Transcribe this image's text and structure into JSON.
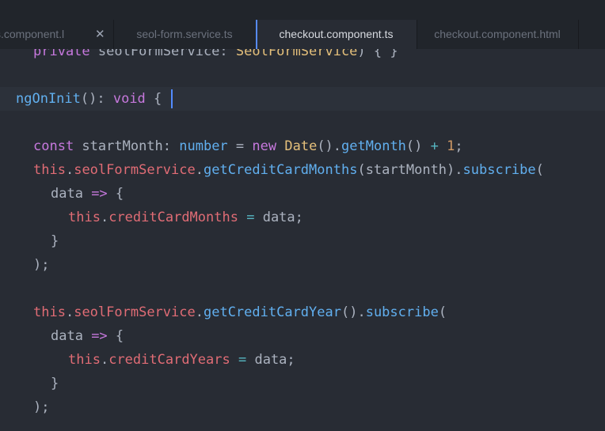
{
  "tabs": [
    {
      "label": "s.component.l",
      "close": "✕"
    },
    {
      "label": "seol-form.service.ts"
    },
    {
      "label": "checkout.component.ts"
    },
    {
      "label": "checkout.component.html"
    }
  ],
  "code": {
    "line0": {
      "a": "private",
      "b": " seolFormService: ",
      "c": "SeolFormService",
      "d": ") { }"
    },
    "line1": {
      "a": "ngOnInit",
      "b": "(): ",
      "c": "void",
      "d": " {"
    },
    "line2": {
      "a": "const",
      "b": " startMonth: ",
      "c": "number",
      "d": " = ",
      "e": "new",
      "f": " ",
      "g": "Date",
      "h": "().",
      "i": "getMonth",
      "j": "() ",
      "k": "+",
      "l": " ",
      "m": "1",
      "n": ";"
    },
    "line3": {
      "a": "this",
      "b": ".",
      "c": "seolFormService",
      "d": ".",
      "e": "getCreditCardMonths",
      "f": "(startMonth).",
      "g": "subscribe",
      "h": "("
    },
    "line4": {
      "a": "data ",
      "b": "=>",
      "c": " {"
    },
    "line5": {
      "a": "this",
      "b": ".",
      "c": "creditCardMonths",
      "d": " ",
      "e": "=",
      "f": " data;"
    },
    "line6": {
      "a": "}"
    },
    "line7": {
      "a": ");"
    },
    "line8": {
      "a": "this",
      "b": ".",
      "c": "seolFormService",
      "d": ".",
      "e": "getCreditCardYear",
      "f": "().",
      "g": "subscribe",
      "h": "("
    },
    "line9": {
      "a": "data ",
      "b": "=>",
      "c": " {"
    },
    "line10": {
      "a": "this",
      "b": ".",
      "c": "creditCardYears",
      "d": " ",
      "e": "=",
      "f": " data;"
    },
    "line11": {
      "a": "}"
    },
    "line12": {
      "a": ");"
    }
  }
}
